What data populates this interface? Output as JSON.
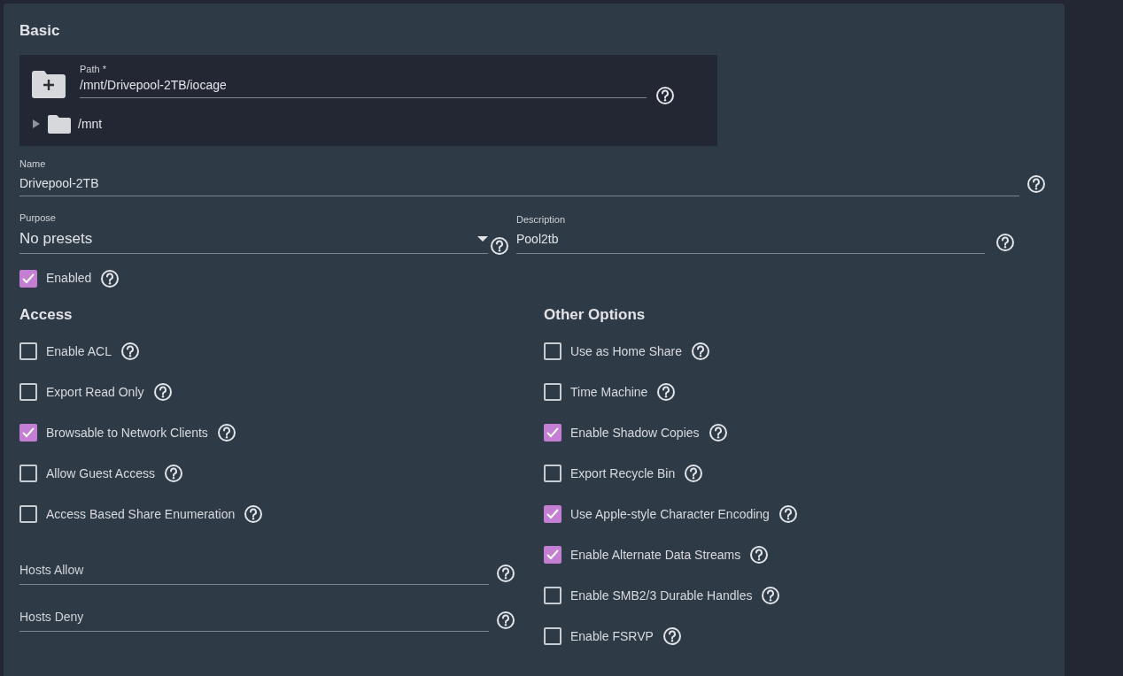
{
  "section_title": "Basic",
  "path": {
    "label": "Path *",
    "value": "/mnt/Drivepool-2TB/iocage",
    "tree": [
      {
        "label": "/mnt",
        "expanded": false
      }
    ]
  },
  "name": {
    "label": "Name",
    "value": "Drivepool-2TB"
  },
  "purpose": {
    "label": "Purpose",
    "value": "No presets"
  },
  "description": {
    "label": "Description",
    "value": "Pool2tb"
  },
  "enabled": {
    "label": "Enabled",
    "checked": true
  },
  "access": {
    "title": "Access",
    "options": [
      {
        "label": "Enable ACL",
        "checked": false
      },
      {
        "label": "Export Read Only",
        "checked": false
      },
      {
        "label": "Browsable to Network Clients",
        "checked": true
      },
      {
        "label": "Allow Guest Access",
        "checked": false
      },
      {
        "label": "Access Based Share Enumeration",
        "checked": false
      }
    ],
    "hosts_allow": {
      "placeholder": "Hosts Allow"
    },
    "hosts_deny": {
      "placeholder": "Hosts Deny"
    }
  },
  "other_options": {
    "title": "Other Options",
    "options": [
      {
        "label": "Use as Home Share",
        "checked": false
      },
      {
        "label": "Time Machine",
        "checked": false
      },
      {
        "label": "Enable Shadow Copies",
        "checked": true
      },
      {
        "label": "Export Recycle Bin",
        "checked": false
      },
      {
        "label": "Use Apple-style Character Encoding",
        "checked": true
      },
      {
        "label": "Enable Alternate Data Streams",
        "checked": true
      },
      {
        "label": "Enable SMB2/3 Durable Handles",
        "checked": false
      },
      {
        "label": "Enable FSRVP",
        "checked": false
      }
    ]
  }
}
